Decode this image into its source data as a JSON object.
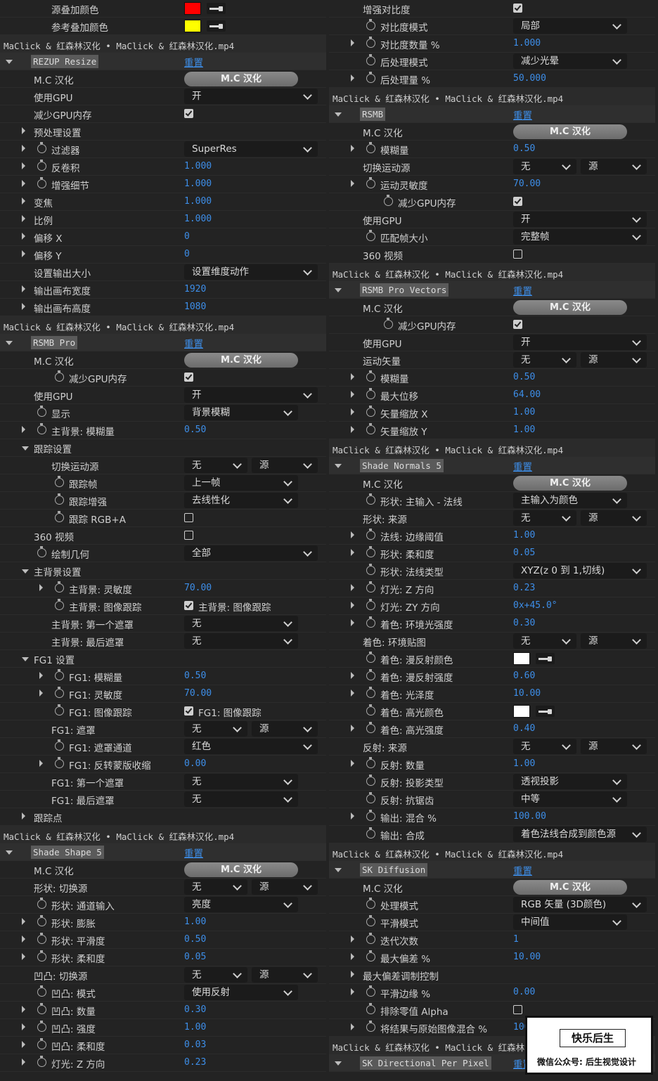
{
  "common": {
    "reset": "重置",
    "layer_header": "MaClick & 红森林汉化 • MaClick & 红森林汉化.mp4",
    "mc_button": "M.C 汉化",
    "src_option": "源"
  },
  "colors": {
    "red": "#ff0000",
    "yellow": "#ffff00",
    "white": "#ffffff",
    "link_blue": "#3d8ee8"
  },
  "left": {
    "top_rows": [
      {
        "label": "源叠加颜色",
        "color": "#ff0000"
      },
      {
        "label": "参考叠加颜色",
        "color": "#ffff00"
      }
    ],
    "rezup": {
      "name": "REZUP Resize",
      "mc_label": "M.C 汉化",
      "use_gpu": {
        "label": "使用GPU",
        "value": "开"
      },
      "reduce_gpu": "减少GPU内存",
      "preprocess": "预处理设置",
      "filter": {
        "label": "过滤器",
        "value": "SuperRes"
      },
      "deconv": {
        "label": "反卷积",
        "value": "1.000"
      },
      "enhance": {
        "label": "增强细节",
        "value": "1.000"
      },
      "zoom": {
        "label": "变焦",
        "value": "1.000"
      },
      "scale": {
        "label": "比例",
        "value": "1.000"
      },
      "offset_x": {
        "label": "偏移 X",
        "value": "0"
      },
      "offset_y": {
        "label": "偏移 Y",
        "value": "0"
      },
      "out_size": {
        "label": "设置输出大小",
        "value": "设置维度动作"
      },
      "out_w": {
        "label": "输出画布宽度",
        "value": "1920"
      },
      "out_h": {
        "label": "输出画布高度",
        "value": "1080"
      }
    },
    "rsmb_pro": {
      "name": "RSMB Pro",
      "mc_label": "M.C 汉化",
      "reduce_gpu": "减少GPU内存",
      "use_gpu": {
        "label": "使用GPU",
        "value": "开"
      },
      "display": {
        "label": "显示",
        "value": "背景模糊"
      },
      "bg_blur": {
        "label": "主背景: 模糊量",
        "value": "0.50"
      },
      "tracking": "跟踪设置",
      "switch_src": {
        "label": "切换运动源",
        "value": "无"
      },
      "track_frame": {
        "label": "跟踪帧",
        "value": "上一帧"
      },
      "track_enh": {
        "label": "跟踪增强",
        "value": "去线性化"
      },
      "track_rgba": "跟踪 RGB+A",
      "v360": "360 视频",
      "draw_geo": {
        "label": "绘制几何",
        "value": "全部"
      },
      "bg_settings": "主背景设置",
      "bg_sens": {
        "label": "主背景: 灵敏度",
        "value": "70.00"
      },
      "bg_track": {
        "label": "主背景: 图像跟踪",
        "check": "主背景: 图像跟踪"
      },
      "bg_first": {
        "label": "主背景: 第一个遮罩",
        "value": "无"
      },
      "bg_last": {
        "label": "主背景: 最后遮罩",
        "value": "无"
      },
      "fg_settings": "FG1 设置",
      "fg_blur": {
        "label": "FG1: 模糊量",
        "value": "0.50"
      },
      "fg_sens": {
        "label": "FG1: 灵敏度",
        "value": "70.00"
      },
      "fg_track": {
        "label": "FG1: 图像跟踪",
        "check": "FG1: 图像跟踪"
      },
      "fg_mask": {
        "label": "FG1: 遮罩",
        "value": "无"
      },
      "fg_channel": {
        "label": "FG1: 遮罩通道",
        "value": "红色"
      },
      "fg_invert": {
        "label": "FG1: 反转蒙版收缩",
        "value": "0.00"
      },
      "fg_first": {
        "label": "FG1: 第一个遮罩",
        "value": "无"
      },
      "fg_last": {
        "label": "FG1: 最后遮罩",
        "value": "无"
      },
      "trackpoint": "跟踪点"
    },
    "shade_shape": {
      "name": "Shade Shape 5",
      "mc_label": "M.C 汉化",
      "shape_src": {
        "label": "形状: 切换源",
        "value": "无"
      },
      "channel_in": {
        "label": "形状: 通道输入",
        "value": "亮度"
      },
      "expand": {
        "label": "形状: 膨胀",
        "value": "1.00"
      },
      "smooth": {
        "label": "形状: 平滑度",
        "value": "0.50"
      },
      "soft": {
        "label": "形状: 柔和度",
        "value": "0.05"
      },
      "bump_src": {
        "label": "凹凸: 切换源",
        "value": "无"
      },
      "bump_mode": {
        "label": "凹凸: 模式",
        "value": "使用反射"
      },
      "bump_amt": {
        "label": "凹凸: 数量",
        "value": "0.30"
      },
      "bump_str": {
        "label": "凹凸: 强度",
        "value": "1.00"
      },
      "bump_soft": {
        "label": "凹凸: 柔和度",
        "value": "0.03"
      },
      "light_z": {
        "label": "灯光: Z 方向",
        "value": "0.23"
      }
    }
  },
  "right": {
    "top": {
      "contrast": "增强对比度",
      "contrast_mode": {
        "label": "对比度模式",
        "value": "局部"
      },
      "contrast_amt": {
        "label": "对比度数量 %",
        "value": "1.000"
      },
      "post_mode": {
        "label": "后处理模式",
        "value": "减少光晕"
      },
      "post_amt": {
        "label": "后处理量 %",
        "value": "50.000"
      }
    },
    "rsmb": {
      "name": "RSMB",
      "mc_label": "M.C 汉化",
      "blur": {
        "label": "模糊量",
        "value": "0.50"
      },
      "switch_src": {
        "label": "切换运动源",
        "value": "无"
      },
      "motion_sens": {
        "label": "运动灵敏度",
        "value": "70.00"
      },
      "reduce_gpu": "减少GPU内存",
      "use_gpu": {
        "label": "使用GPU",
        "value": "开"
      },
      "match_frame": {
        "label": "匹配帧大小",
        "value": "完整帧"
      },
      "v360": "360 视频"
    },
    "rsmb_vec": {
      "name": "RSMB Pro Vectors",
      "mc_label": "M.C 汉化",
      "reduce_gpu": "减少GPU内存",
      "use_gpu": {
        "label": "使用GPU",
        "value": "开"
      },
      "motion_vec": {
        "label": "运动矢量",
        "value": "无"
      },
      "blur": {
        "label": "模糊量",
        "value": "0.50"
      },
      "max_disp": {
        "label": "最大位移",
        "value": "64.00"
      },
      "vec_x": {
        "label": "矢量缩放 X",
        "value": "1.00"
      },
      "vec_y": {
        "label": "矢量缩放 Y",
        "value": "1.00"
      }
    },
    "shade_normals": {
      "name": "Shade Normals 5",
      "mc_label": "M.C 汉化",
      "shape_main": {
        "label": "形状: 主输入 - 法线",
        "value": "主输入为颜色"
      },
      "shape_src": {
        "label": "形状: 来源",
        "value": "无"
      },
      "edge_thr": {
        "label": "法线: 边缘阈值",
        "value": "1.00"
      },
      "shape_soft": {
        "label": "形状: 柔和度",
        "value": "0.05"
      },
      "normal_type": {
        "label": "形状: 法线类型",
        "value": "XYZ(z 0 到 1,切线)"
      },
      "light_z": {
        "label": "灯光: Z 方向",
        "value": "0.23"
      },
      "light_zy": {
        "label": "灯光: ZY 方向",
        "value": "0x+45.0°"
      },
      "ambient": {
        "label": "着色: 环境光强度",
        "value": "0.30"
      },
      "env_map": {
        "label": "着色: 环境贴图",
        "value": "无"
      },
      "diffuse_col": {
        "label": "着色: 漫反射颜色",
        "color": "#ffffff"
      },
      "diffuse_str": {
        "label": "着色: 漫反射强度",
        "value": "0.60"
      },
      "gloss": {
        "label": "着色: 光泽度",
        "value": "10.00"
      },
      "spec_col": {
        "label": "着色: 高光颜色",
        "color": "#ffffff"
      },
      "spec_str": {
        "label": "着色: 高光强度",
        "value": "0.40"
      },
      "refl_src": {
        "label": "反射: 来源",
        "value": "无"
      },
      "refl_amt": {
        "label": "反射: 数量",
        "value": "1.00"
      },
      "proj_type": {
        "label": "反射: 投影类型",
        "value": "透视投影"
      },
      "antialias": {
        "label": "反射: 抗锯齿",
        "value": "中等"
      },
      "out_mix": {
        "label": "输出: 混合 %",
        "value": "100.00"
      },
      "out_comp": {
        "label": "输出: 合成",
        "value": "着色法线合成到颜色源"
      }
    },
    "sk_diffusion": {
      "name": "SK Diffusion",
      "mc_label": "M.C 汉化",
      "proc_mode": {
        "label": "处理模式",
        "value": "RGB 矢量 (3D颜色)"
      },
      "smooth_mode": {
        "label": "平滑模式",
        "value": "中间值"
      },
      "iterations": {
        "label": "迭代次数",
        "value": "1"
      },
      "max_dev": {
        "label": "最大偏差 %",
        "value": "10.00"
      },
      "max_dev_ctrl": "最大偏差调制控制",
      "smooth_edge": {
        "label": "平滑边缘 %",
        "value": "0.00"
      },
      "exclude_alpha": "排除零值 Alpha",
      "blend": {
        "label": "将结果与原始图像混合 %",
        "value": "100.00"
      }
    },
    "sk_directional": {
      "name": "SK Directional Per Pixel"
    }
  },
  "badge": {
    "title": "快乐后生",
    "subtitle": "微信公众号: 后生视觉设计"
  }
}
